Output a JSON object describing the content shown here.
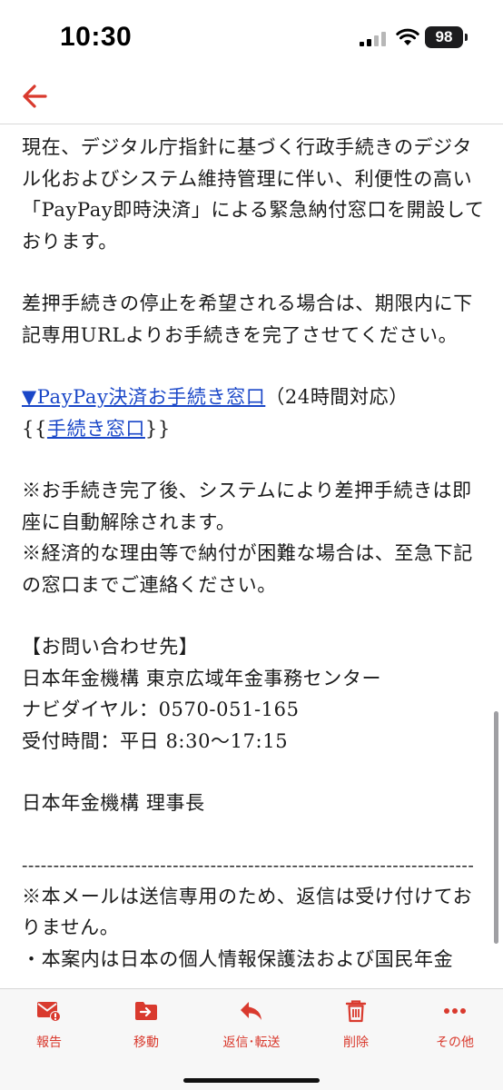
{
  "status_bar": {
    "time": "10:30",
    "battery": "98"
  },
  "nav": {
    "back_icon": "back-arrow-icon"
  },
  "body": {
    "para1": "現在、デジタル庁指針に基づく行政手続きのデジタル化およびシステム維持管理に伴い、利便性の高い「PayPay即時決済」による緊急納付窓口を開設しております。",
    "para2": "差押手続きの停止を希望される場合は、期限内に下記専用URLよりお手続きを完了させてください。",
    "link1": "▼PayPay決済お手続き窓口",
    "link1_suffix": "（24時間対応）",
    "link2_prefix": "{{",
    "link2": "手続き窓口",
    "link2_suffix": "}}",
    "note1": "※お手続き完了後、システムにより差押手続きは即座に自動解除されます。",
    "note2": "※経済的な理由等で納付が困難な場合は、至急下記の窓口までご連絡ください。",
    "contact_heading": "【お問い合わせ先】",
    "contact_org": "日本年金機構 東京広域年金事務センター",
    "contact_phone": "ナビダイヤル：0570-051-165",
    "contact_hours": "受付時間：平日 8:30〜17:15",
    "signature": "日本年金機構 理事長",
    "separator": "------------------------------------------------------------------------",
    "footer1": "※本メールは送信専用のため、返信は受け付けておりません。",
    "footer2": "・本案内は日本の個人情報保護法および国民年金"
  },
  "toolbar": {
    "report": "報告",
    "move": "移動",
    "reply": "返信･転送",
    "delete": "削除",
    "more": "その他"
  },
  "colors": {
    "accent": "#d93a2e",
    "link": "#1a47c8"
  }
}
